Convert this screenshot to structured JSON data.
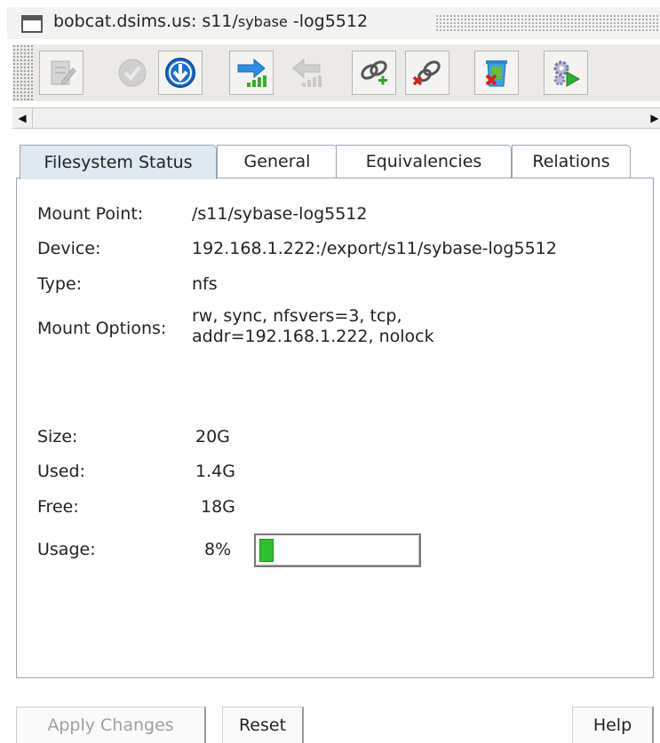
{
  "window": {
    "title_host": "bobcat.dsims.us: s11/",
    "title_mid": "sybase",
    "title_tail": " -log5512"
  },
  "toolbar": {
    "buttons": [
      {
        "icon": "edit-icon",
        "enabled": false
      },
      {
        "icon": "check-circle-icon",
        "enabled": false
      },
      {
        "icon": "download-arrow-icon",
        "enabled": true
      },
      {
        "icon": "forward-transfer-icon",
        "enabled": true
      },
      {
        "icon": "back-transfer-icon",
        "enabled": false
      },
      {
        "icon": "link-add-icon",
        "enabled": true
      },
      {
        "icon": "link-remove-icon",
        "enabled": true
      },
      {
        "icon": "delete-bin-icon",
        "enabled": true
      },
      {
        "icon": "run-gears-icon",
        "enabled": true
      }
    ]
  },
  "tabs": [
    "Filesystem Status",
    "General",
    "Equivalencies",
    "Relations"
  ],
  "active_tab": "Filesystem Status",
  "status": {
    "mount_point_label": "Mount Point:",
    "mount_point": "/s11/sybase-log5512",
    "device_label": "Device:",
    "device": "192.168.1.222:/export/s11/sybase-log5512",
    "type_label": "Type:",
    "type": "nfs",
    "mount_options_label": "Mount Options:",
    "mount_options_line1": "rw, sync, nfsvers=3, tcp,",
    "mount_options_line2": "addr=192.168.1.222, nolock",
    "size_label": "Size:",
    "size": "20G",
    "used_label": "Used:",
    "used": "1.4G",
    "free_label": "Free:",
    "free": "18G",
    "usage_label": "Usage:",
    "usage": "8%",
    "usage_fraction": 0.08,
    "usage_color": "#2ec02e"
  },
  "buttons": {
    "apply": "Apply Changes",
    "reset": "Reset",
    "help": "Help"
  }
}
